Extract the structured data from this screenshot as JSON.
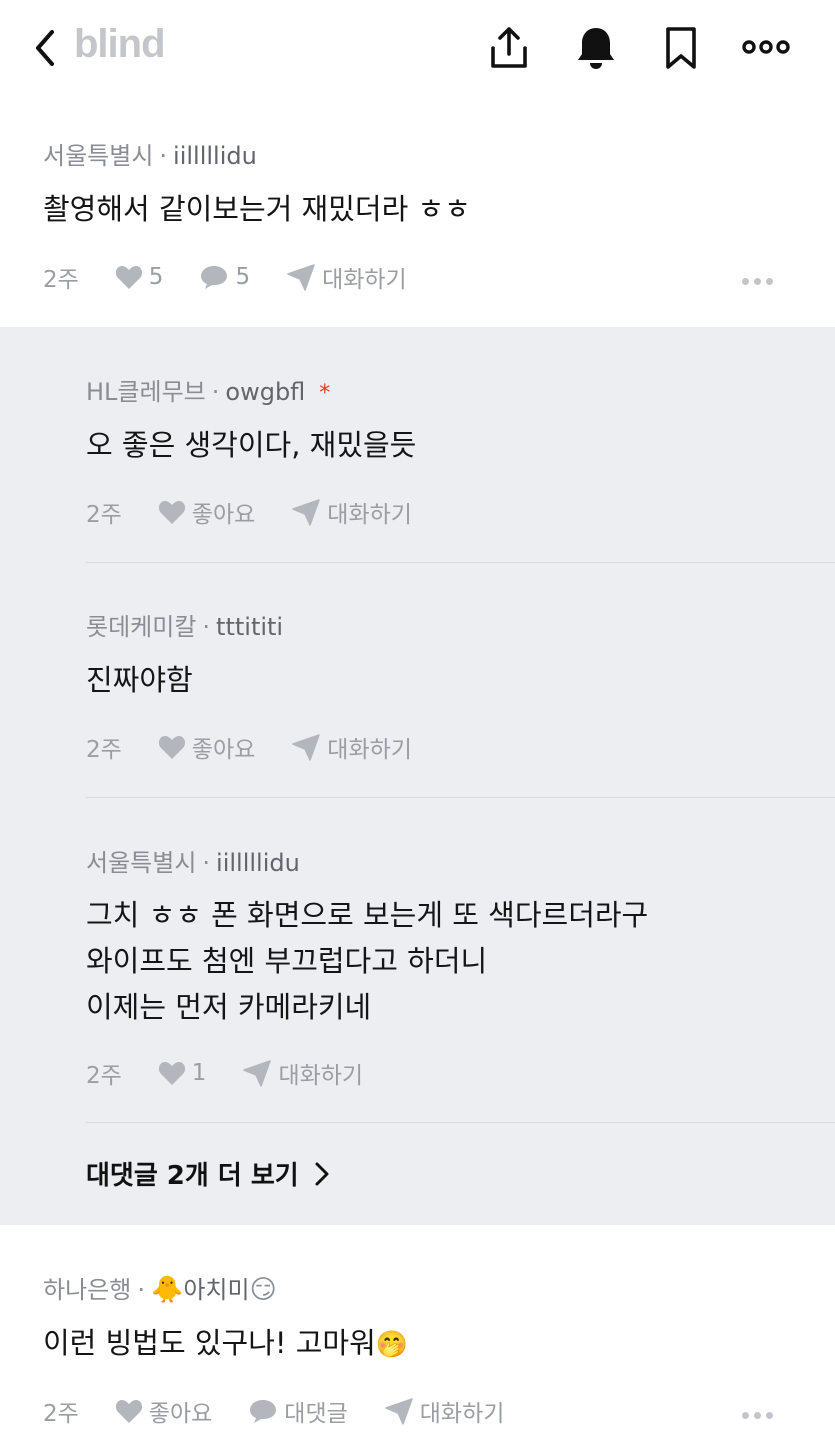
{
  "header": {
    "logo": "blind",
    "back_icon": "chevron-left-icon",
    "share_icon": "share-icon",
    "bell_icon": "bell-icon",
    "bookmark_icon": "bookmark-icon",
    "more_icon": "more-icon"
  },
  "comments": [
    {
      "company": "서울특별시",
      "handle": "iilllllidu",
      "text": "촬영해서 같이보는거 재밌더라 ㅎㅎ",
      "time": "2주",
      "likes": "5",
      "replies": "5",
      "chat": "대화하기"
    },
    {
      "company": "하나은행",
      "handle_emoji": "🐥",
      "handle": "아치미",
      "handle_emoji2": "😏",
      "text": "이런 빙법도 있구나! 고마워",
      "text_emoji": "🤭",
      "time": "2주",
      "like_label": "좋아요",
      "reply_label": "대댓글",
      "chat": "대화하기"
    }
  ],
  "replies": [
    {
      "company": "HL클레무브",
      "handle": "owgbfl",
      "star": "*",
      "text": "오 좋은 생각이다, 재밌을듯",
      "time": "2주",
      "like_label": "좋아요",
      "chat": "대화하기"
    },
    {
      "company": "롯데케미칼",
      "handle": "tttititi",
      "text": "진짜야함",
      "time": "2주",
      "like_label": "좋아요",
      "chat": "대화하기"
    },
    {
      "company": "서울특별시",
      "handle": "iilllllidu",
      "lines": [
        "그치 ㅎㅎ 폰 화면으로 보는게 또 색다르더라구",
        "와이프도 첨엔 부끄럽다고 하더니",
        "이제는 먼저 카메라키네"
      ],
      "time": "2주",
      "likes": "1",
      "chat": "대화하기"
    }
  ],
  "more_replies": "대댓글 2개 더 보기",
  "colors": {
    "reply_bg": "#eceef2",
    "meta": "#8a8d94",
    "star": "#e0392b"
  }
}
